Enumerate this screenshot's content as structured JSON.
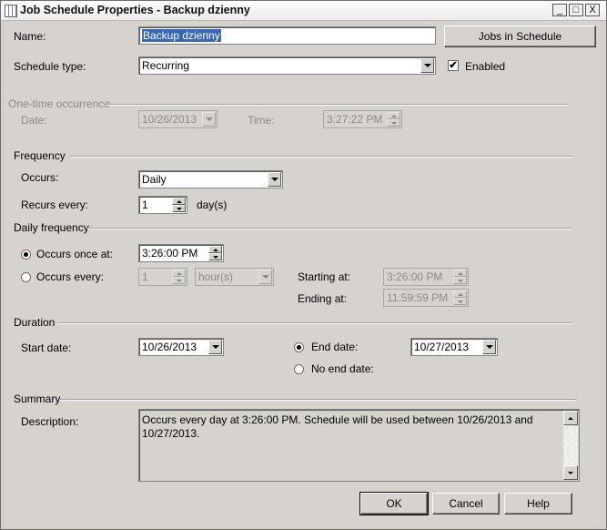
{
  "window": {
    "title": "Job Schedule Properties - Backup dzienny",
    "controls": {
      "minimize": "_",
      "maximize": "□",
      "close": "X"
    }
  },
  "name": {
    "label": "Name:",
    "value": "Backup dzienny",
    "jobs_button": "Jobs in Schedule"
  },
  "schedule_type": {
    "label": "Schedule type:",
    "value": "Recurring",
    "enabled_label": "Enabled",
    "enabled_checked": true
  },
  "one_time": {
    "section": "One-time occurrence",
    "date_label": "Date:",
    "date_value": "10/26/2013",
    "time_label": "Time:",
    "time_value": "3:27:22 PM"
  },
  "frequency": {
    "section": "Frequency",
    "occurs_label": "Occurs:",
    "occurs_value": "Daily",
    "recurs_label": "Recurs every:",
    "recurs_value": "1",
    "recurs_unit": "day(s)"
  },
  "daily_frequency": {
    "section": "Daily frequency",
    "once_label": "Occurs once at:",
    "once_value": "3:26:00 PM",
    "once_selected": true,
    "every_label": "Occurs every:",
    "every_value": "1",
    "every_unit": "hour(s)",
    "starting_label": "Starting at:",
    "starting_value": "3:26:00 PM",
    "ending_label": "Ending at:",
    "ending_value": "11:59:59 PM"
  },
  "duration": {
    "section": "Duration",
    "start_label": "Start date:",
    "start_value": "10/26/2013",
    "end_label": "End date:",
    "end_value": "10/27/2013",
    "end_selected": true,
    "no_end_label": "No end date:"
  },
  "summary": {
    "section": "Summary",
    "description_label": "Description:",
    "description": "Occurs every day at 3:26:00 PM. Schedule will be used between 10/26/2013 and 10/27/2013."
  },
  "buttons": {
    "ok": "OK",
    "cancel": "Cancel",
    "help": "Help"
  },
  "icons": {
    "window": "app-window-icon",
    "dropdown": "chevron-down-icon",
    "check": "✔"
  }
}
